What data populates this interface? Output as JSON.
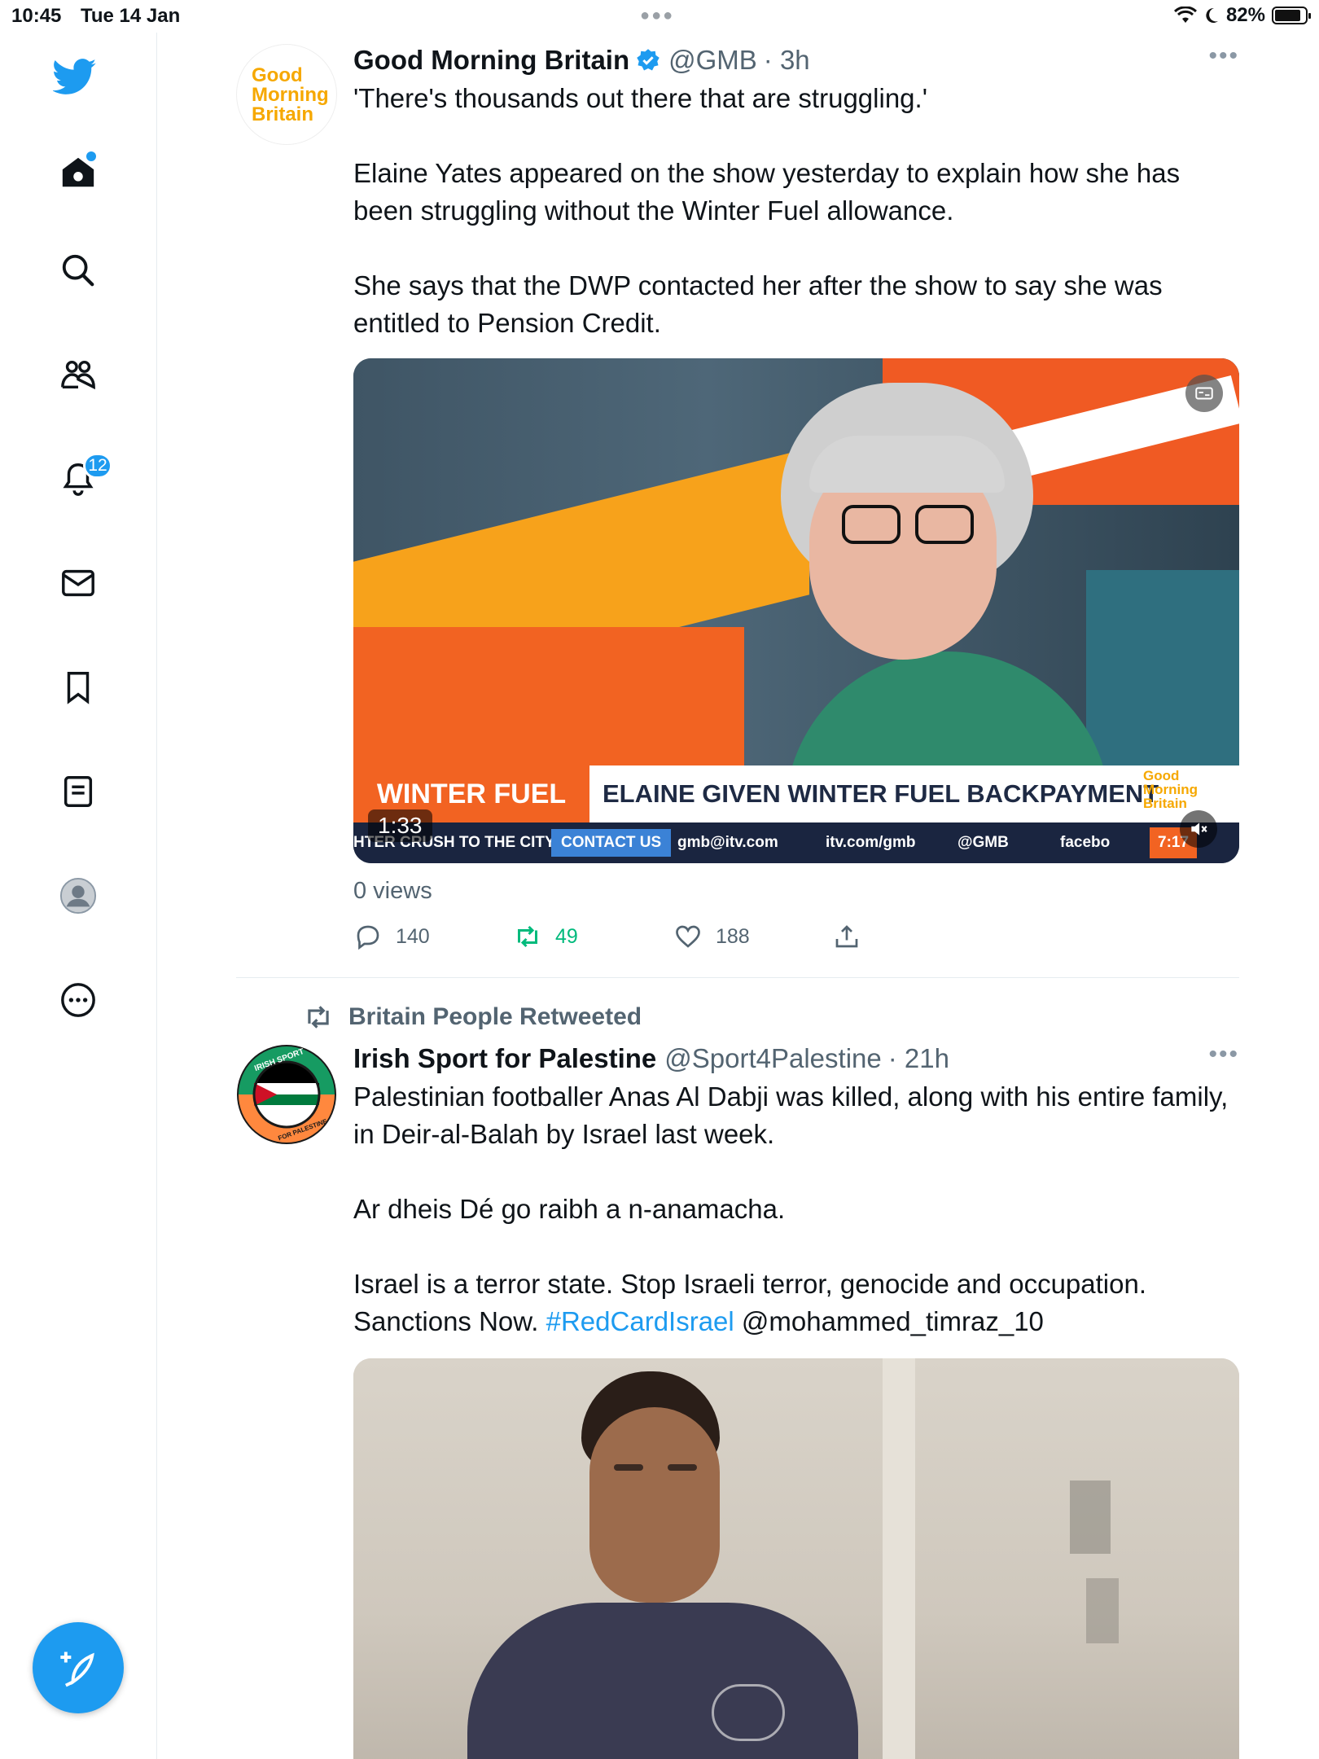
{
  "status_bar": {
    "time": "10:45",
    "date": "Tue 14 Jan",
    "battery": "82%",
    "battery_level": 0.82
  },
  "sidebar": {
    "items": [
      {
        "name": "home",
        "icon": "home-icon"
      },
      {
        "name": "explore",
        "icon": "search-icon"
      },
      {
        "name": "communities",
        "icon": "communities-icon"
      },
      {
        "name": "notifications",
        "icon": "bell-icon",
        "badge": "12"
      },
      {
        "name": "messages",
        "icon": "mail-icon"
      },
      {
        "name": "bookmarks",
        "icon": "bookmark-icon"
      },
      {
        "name": "lists",
        "icon": "list-icon"
      },
      {
        "name": "profile",
        "icon": "avatar-icon"
      },
      {
        "name": "more",
        "icon": "more-circle-icon"
      }
    ],
    "compose_icon": "compose-feather-icon",
    "accent": "#1d9bf0"
  },
  "tweets": [
    {
      "avatar_text": [
        "Good",
        "Morning",
        "Britain"
      ],
      "name": "Good Morning Britain",
      "verified": true,
      "handle": "@GMB",
      "time": "· 3h",
      "paragraphs": [
        "'There's thousands out there that are struggling.'",
        "Elaine Yates appeared on the show yesterday to explain how she has been struggling without the Winter Fuel allowance.",
        "She says that the DWP contacted her after the show to say she was entitled to Pension Credit."
      ],
      "video": {
        "lower_third_tag": "WINTER FUEL",
        "lower_third_headline": "ELAINE GIVEN WINTER FUEL BACKPAYMENT",
        "ticker": [
          "HTER CRUSH TO THE CITY",
          "CONTACT US",
          "gmb@itv.com",
          "itv.com/gmb",
          "@GMB",
          "facebo"
        ],
        "ticker_time": "7:17",
        "logo_text": [
          "Good",
          "Morning",
          "Britain"
        ],
        "duration": "1:33"
      },
      "views": "0 views",
      "replies": "140",
      "retweets": "49",
      "likes": "188"
    },
    {
      "retweeted_by": "Britain People Retweeted",
      "avatar_ring_top": "IRISH SPORT",
      "avatar_ring_bottom": "FOR PALESTINE",
      "name": "Irish Sport for Palestine",
      "handle": "@Sport4Palestine",
      "time": "· 21h",
      "paragraphs": [
        "Palestinian footballer Anas Al Dabji was killed, along with his entire family, in Deir-al-Balah by Israel last week.",
        "Ar dheis Dé go raibh a n-anamacha.",
        "Israel is a terror state. Stop Israeli terror, genocide and occupation."
      ],
      "last_line_prefix": "Sanctions Now. ",
      "hashtag": "#RedCardIsrael",
      "mention": " @mohammed_timraz_10"
    }
  ]
}
